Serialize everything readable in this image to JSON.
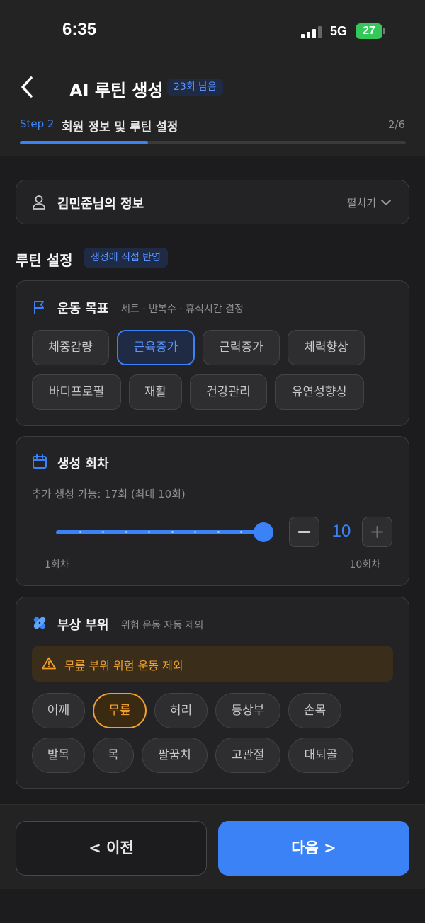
{
  "status_bar": {
    "time": "6:35",
    "network": "5G",
    "battery": "27"
  },
  "header": {
    "title": "AI 루틴 생성",
    "remaining_badge": "23회 남음",
    "step_label": "Step 2",
    "step_title": "회원 정보 및 루틴 설정",
    "step_count": "2/6",
    "progress_fraction": 0.333
  },
  "member_info": {
    "title": "김민준님의 정보",
    "expand_label": "펼치기"
  },
  "routine_settings": {
    "title": "루틴 설정",
    "badge": "생성에 직접 반영"
  },
  "goal": {
    "title": "운동 목표",
    "subtitle": "세트 · 반복수 · 휴식시간 결정",
    "options": [
      "체중감량",
      "근육증가",
      "근력증가",
      "체력향상",
      "바디프로필",
      "재활",
      "건강관리",
      "유연성향상"
    ],
    "selected": "근육증가"
  },
  "count": {
    "title": "생성 회차",
    "availability": "추가 생성 가능: 17회 (최대 10회)",
    "value": "10",
    "min_label": "1회차",
    "max_label": "10회차",
    "minus": "−",
    "plus": "+"
  },
  "injury": {
    "title": "부상 부위",
    "subtitle": "위험 운동 자동 제외",
    "warning": "무릎 부위 위험 운동 제외",
    "options": [
      "어깨",
      "무릎",
      "허리",
      "등상부",
      "손목",
      "발목",
      "목",
      "팔꿈치",
      "고관절",
      "대퇴골"
    ],
    "selected": "무릎"
  },
  "footer": {
    "prev_label": "< 이전",
    "next_label": "다음 >"
  },
  "colors": {
    "accent": "#3b82f6",
    "warning": "#f0a030",
    "background": "#1c1c1e"
  }
}
